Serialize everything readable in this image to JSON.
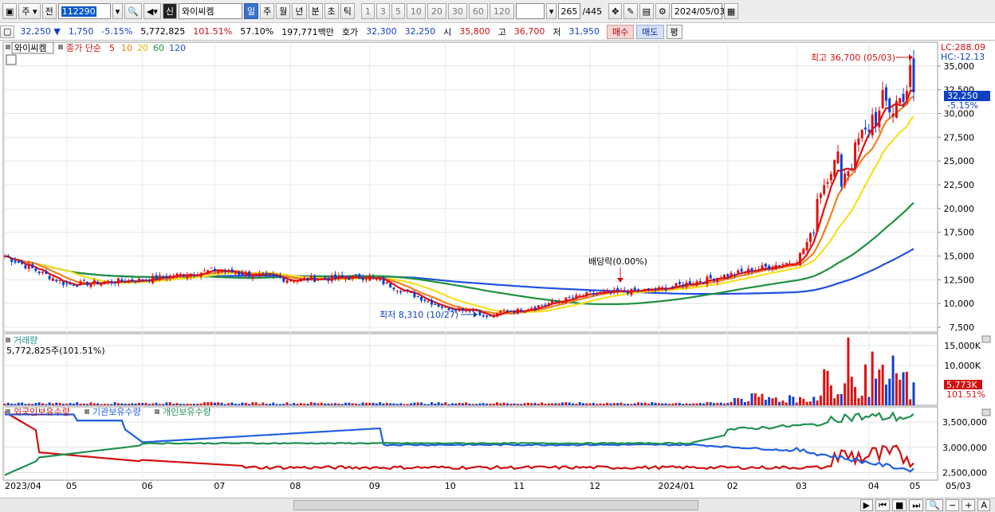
{
  "toolbar": {
    "market": "주",
    "prev": "전",
    "code": "112290",
    "name_badge": "신",
    "stock_name": "와이씨켐",
    "period_tabs": [
      "일",
      "주",
      "월",
      "년",
      "분",
      "초",
      "틱"
    ],
    "active_period": "일",
    "intervals": [
      "1",
      "3",
      "5",
      "10",
      "20",
      "30",
      "60",
      "120"
    ],
    "count": "265",
    "count_total": "/445",
    "date": "2024/05/03"
  },
  "info": {
    "price": "32,250",
    "change": "1,750",
    "change_pct": "-5.15%",
    "volume": "5,772,825",
    "vol_ratio": "101.51%",
    "turnover": "57.10%",
    "amount": "197,771백만",
    "ask_label": "호가",
    "ask": "32,300",
    "bid": "32,250",
    "open_label": "시",
    "open": "35,800",
    "high_label": "고",
    "high": "36,700",
    "low_label": "저",
    "low": "31,950",
    "buy": "매수",
    "sell": "매도",
    "eval": "평"
  },
  "price_panel": {
    "stock_label": "와이씨켐",
    "ma_label": "종가 단순",
    "ma_periods": [
      "5",
      "10",
      "20",
      "60",
      "120"
    ],
    "lc": "LC:288.09",
    "hc": "HC:-12.13",
    "y_ticks": [
      "35,000",
      "32,500",
      "30,000",
      "27,500",
      "25,000",
      "22,500",
      "20,000",
      "17,500",
      "15,000",
      "12,500",
      "10,000",
      "7,500"
    ],
    "current_tag": "32,250",
    "current_pct": "-5.15%",
    "high_annot": "최고 36,700 (05/03)",
    "low_annot": "최저 8,310 (10/27)",
    "div_annot": "배당락(0.00%)"
  },
  "volume_panel": {
    "title": "거래량",
    "summary": "5,772,825주(101.51%)",
    "y_ticks": [
      "15,000K",
      "10,000K"
    ],
    "current_tag": "5,773K",
    "current_pct": "101.51%"
  },
  "holding_panel": {
    "series": [
      "외국인보유수량",
      "기관보유수량",
      "개인보유수량"
    ],
    "y_ticks": [
      "3,500,000",
      "3,000,000",
      "2,500,000"
    ]
  },
  "x_axis": [
    "2023/04",
    "05",
    "06",
    "07",
    "08",
    "09",
    "10",
    "11",
    "12",
    "2024/01",
    "02",
    "03",
    "04",
    "05",
    "05/03"
  ],
  "chart_data": {
    "type": "candlestick",
    "series_name": "와이씨켐",
    "x_range": [
      "2023/04",
      "2024/05/03"
    ],
    "ylim": [
      7000,
      37500
    ],
    "monthly_close": [
      {
        "x": "2023/04",
        "y": 15000
      },
      {
        "x": "05",
        "y": 12000
      },
      {
        "x": "06",
        "y": 12500
      },
      {
        "x": "07",
        "y": 13500
      },
      {
        "x": "08",
        "y": 12500
      },
      {
        "x": "09",
        "y": 12800
      },
      {
        "x": "10",
        "y": 9500
      },
      {
        "x": "11",
        "y": 9200
      },
      {
        "x": "12",
        "y": 11000
      },
      {
        "x": "2024/01",
        "y": 11500
      },
      {
        "x": "02",
        "y": 13000
      },
      {
        "x": "03",
        "y": 14500
      },
      {
        "x": "04",
        "y": 28000
      },
      {
        "x": "05",
        "y": 32250
      }
    ],
    "high": {
      "date": "05/03",
      "value": 36700
    },
    "low": {
      "date": "10/27",
      "value": 8310
    },
    "colors": {
      "ma5": "#e01010",
      "ma10": "#f08020",
      "ma20": "#f5e020",
      "ma60": "#209040",
      "ma120": "#2050e0",
      "up": "#e01010",
      "down": "#1040d0",
      "foreign": "#d01010",
      "institution": "#2060e0",
      "individual": "#209050"
    }
  }
}
